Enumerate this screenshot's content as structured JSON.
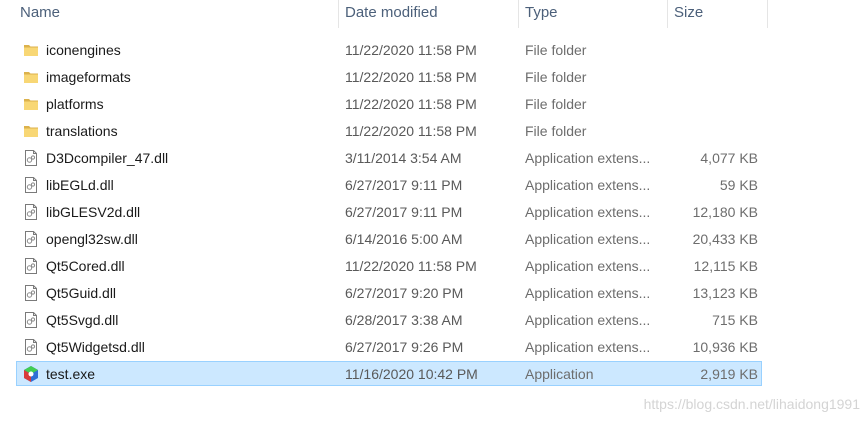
{
  "columns": {
    "name": "Name",
    "date": "Date modified",
    "type": "Type",
    "size": "Size"
  },
  "files": [
    {
      "name": "iconengines",
      "date": "11/22/2020 11:58 PM",
      "type": "File folder",
      "size": "",
      "icon": "folder-icon"
    },
    {
      "name": "imageformats",
      "date": "11/22/2020 11:58 PM",
      "type": "File folder",
      "size": "",
      "icon": "folder-icon"
    },
    {
      "name": "platforms",
      "date": "11/22/2020 11:58 PM",
      "type": "File folder",
      "size": "",
      "icon": "folder-icon"
    },
    {
      "name": "translations",
      "date": "11/22/2020 11:58 PM",
      "type": "File folder",
      "size": "",
      "icon": "folder-icon"
    },
    {
      "name": "D3Dcompiler_47.dll",
      "date": "3/11/2014 3:54 AM",
      "type": "Application extens...",
      "size": "4,077 KB",
      "icon": "dll-file-icon"
    },
    {
      "name": "libEGLd.dll",
      "date": "6/27/2017 9:11 PM",
      "type": "Application extens...",
      "size": "59 KB",
      "icon": "dll-file-icon"
    },
    {
      "name": "libGLESV2d.dll",
      "date": "6/27/2017 9:11 PM",
      "type": "Application extens...",
      "size": "12,180 KB",
      "icon": "dll-file-icon"
    },
    {
      "name": "opengl32sw.dll",
      "date": "6/14/2016 5:00 AM",
      "type": "Application extens...",
      "size": "20,433 KB",
      "icon": "dll-file-icon"
    },
    {
      "name": "Qt5Cored.dll",
      "date": "11/22/2020 11:58 PM",
      "type": "Application extens...",
      "size": "12,115 KB",
      "icon": "dll-file-icon"
    },
    {
      "name": "Qt5Guid.dll",
      "date": "6/27/2017 9:20 PM",
      "type": "Application extens...",
      "size": "13,123 KB",
      "icon": "dll-file-icon"
    },
    {
      "name": "Qt5Svgd.dll",
      "date": "6/28/2017 3:38 AM",
      "type": "Application extens...",
      "size": "715 KB",
      "icon": "dll-file-icon"
    },
    {
      "name": "Qt5Widgetsd.dll",
      "date": "6/27/2017 9:26 PM",
      "type": "Application extens...",
      "size": "10,936 KB",
      "icon": "dll-file-icon"
    },
    {
      "name": "test.exe",
      "date": "11/16/2020 10:42 PM",
      "type": "Application",
      "size": "2,919 KB",
      "icon": "application-icon",
      "selected": true
    }
  ],
  "watermark": "https://blog.csdn.net/lihaidong1991",
  "colors": {
    "header_text": "#4c607a",
    "selection_bg": "#cce8ff",
    "selection_border": "#99d1ff",
    "folder": "#f8d775"
  }
}
